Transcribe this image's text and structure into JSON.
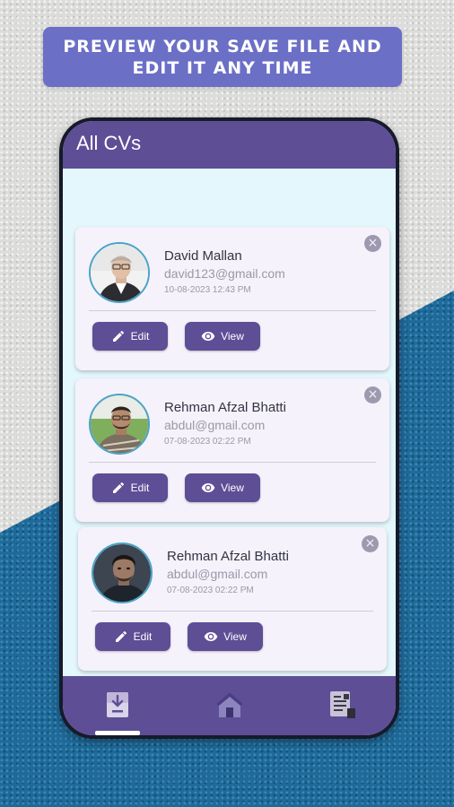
{
  "banner": {
    "text": "Preview your save file and edit it any time"
  },
  "app": {
    "title": "All CVs"
  },
  "colors": {
    "primary": "#5d4e96",
    "banner": "#6b6fc6",
    "screen_bg": "#e3f7fc",
    "card_bg": "#f5f2fb"
  },
  "cards": [
    {
      "name": "David Mallan",
      "email": "david123@gmail.com",
      "date": "10-08-2023 12:43 PM",
      "edit_label": "Edit",
      "view_label": "View",
      "avatar_icon": "person-photo-icon"
    },
    {
      "name": "Rehman Afzal Bhatti",
      "email": "abdul@gmail.com",
      "date": "07-08-2023 02:22 PM",
      "edit_label": "Edit",
      "view_label": "View",
      "avatar_icon": "person-photo-icon"
    },
    {
      "name": "Rehman Afzal Bhatti",
      "email": "abdul@gmail.com",
      "date": "07-08-2023 02:22 PM",
      "edit_label": "Edit",
      "view_label": "View",
      "avatar_icon": "person-photo-icon"
    }
  ],
  "bottom_nav": [
    {
      "icon": "download-file-icon",
      "active": true
    },
    {
      "icon": "home-icon",
      "active": false
    },
    {
      "icon": "resume-document-icon",
      "active": false
    }
  ]
}
